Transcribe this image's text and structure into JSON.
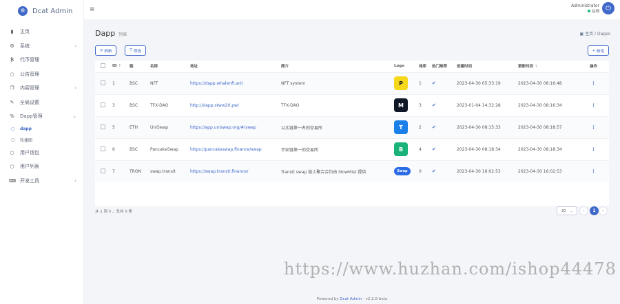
{
  "brand": {
    "name": "Dcat Admin"
  },
  "header": {
    "username": "Administrator",
    "status": "在线"
  },
  "sidebar": {
    "items": [
      {
        "label": "主页",
        "icon": "bar-chart-icon",
        "glyph": "▮"
      },
      {
        "label": "系统",
        "icon": "gear-icon",
        "glyph": "⚙",
        "chevron": "‹"
      },
      {
        "label": "代币管理",
        "icon": "bitcoin-icon",
        "glyph": "₿"
      },
      {
        "label": "公告管理",
        "icon": "circle-icon",
        "glyph": "○"
      },
      {
        "label": "内容管理",
        "icon": "copy-icon",
        "glyph": "❐",
        "chevron": "‹"
      },
      {
        "label": "全局设置",
        "icon": "wrench-icon",
        "glyph": "✎"
      },
      {
        "label": "Dapp管理",
        "icon": "link-icon",
        "glyph": "%",
        "chevron": "⌄"
      },
      {
        "label": "dapp",
        "icon": "circle-icon",
        "glyph": "○",
        "sub": true,
        "active": true
      },
      {
        "label": "轮播图",
        "icon": "circle-icon",
        "glyph": "○",
        "sub": true
      },
      {
        "label": "用户钱包",
        "icon": "circle-icon",
        "glyph": "○"
      },
      {
        "label": "用户列表",
        "icon": "circle-icon",
        "glyph": "○"
      },
      {
        "label": "开发工具",
        "icon": "keyboard-icon",
        "glyph": "⌨",
        "chevron": "‹"
      }
    ]
  },
  "page": {
    "title": "Dapp",
    "subtitle": "列表",
    "breadcrumb_home": "主页",
    "breadcrumb_current": "Dapps"
  },
  "toolbar": {
    "refresh_label": "刷新",
    "filter_label": "筛选",
    "new_label": "新增"
  },
  "table": {
    "headers": {
      "id": "ID",
      "chain": "链",
      "name": "名称",
      "url": "地址",
      "desc": "简介",
      "logo": "Logo",
      "sort": "排序",
      "hot": "热门推荐",
      "created": "创建时间",
      "updated": "更新时间",
      "action": "操作"
    },
    "rows": [
      {
        "id": "1",
        "chain": "BSC",
        "name": "NFT",
        "url": "https://dapp.whalenft.art/",
        "desc": "NFT system",
        "logo_text": "P",
        "logo_color": "#f5d81a",
        "logo_fg": "#222",
        "sort": "1",
        "created": "2023-04-30 05:33:19",
        "updated": "2023-04-30 08:16:48"
      },
      {
        "id": "3",
        "chain": "BSC",
        "name": "TFX-DAO",
        "url": "http://dapp.stww20.pw/",
        "desc": "TFX-DAO",
        "logo_text": "M",
        "logo_color": "#101828",
        "logo_fg": "#fff",
        "sort": "3",
        "created": "2023-01-04 14:32:28",
        "updated": "2023-04-30 08:16:34"
      },
      {
        "id": "5",
        "chain": "ETH",
        "name": "UniSwap",
        "url": "https://app.uniswap.org/#/swap",
        "desc": "以太链第一名的交易所",
        "logo_text": "T",
        "logo_color": "#1a7fe8",
        "logo_fg": "#fff",
        "sort": "2",
        "created": "2023-04-30 08:15:33",
        "updated": "2023-04-30 08:18:57"
      },
      {
        "id": "6",
        "chain": "BSC",
        "name": "PancakeSwap",
        "url": "https://pancakeswap.finance/swap",
        "desc": "币安链第一的交易所",
        "logo_text": "B",
        "logo_color": "#19b37a",
        "logo_fg": "#fff",
        "sort": "4",
        "created": "2023-04-30 08:18:34",
        "updated": "2023-04-30 08:18:34"
      },
      {
        "id": "7",
        "chain": "TRON",
        "name": "swap.transit",
        "url": "https://swap.transit.finance/",
        "desc": "Transit swap 链上聚合合约由 SlowMist 提供",
        "logo_text": "Swap",
        "logo_color": "#2b6be6",
        "logo_fg": "#fff",
        "sort": "0",
        "created": "2023-04-30 16:02:53",
        "updated": "2023-04-30 16:02:53"
      }
    ]
  },
  "pager": {
    "info": "从 1 到 5 ，总共 5 条",
    "per_page": "20",
    "current": "1"
  },
  "watermark": "https://www.huzhan.com/ishop44478",
  "footer": {
    "prefix": "Powered by",
    "link": "Dcat Admin",
    "version": "· v2.2.0-beta"
  },
  "colors": {
    "accent": "#3f68c9",
    "success": "#21b978"
  }
}
